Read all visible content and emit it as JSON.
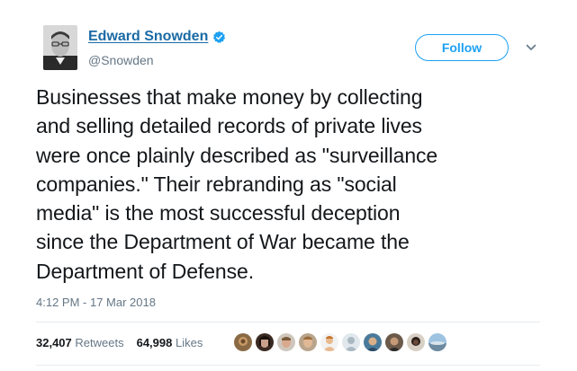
{
  "author": {
    "name": "Edward Snowden",
    "handle": "@Snowden",
    "verified": true
  },
  "actions": {
    "follow_label": "Follow",
    "caret_icon": "chevron-down-icon"
  },
  "tweet": {
    "lines": [
      "Businesses that make money by collecting",
      "and selling detailed records of private lives",
      "were once plainly described as \"surveillance",
      "companies.\" Their rebranding as \"social",
      "media\" is the most successful deception",
      "since the Department of War became the",
      "Department of Defense."
    ],
    "timestamp": "4:12 PM - 17 Mar 2018"
  },
  "stats": {
    "retweets_count": "32,407",
    "retweets_label": "Retweets",
    "likes_count": "64,998",
    "likes_label": "Likes"
  },
  "colors": {
    "link": "#1b6aa5",
    "accent": "#1da1f2",
    "muted": "#657786",
    "text": "#14171a"
  }
}
